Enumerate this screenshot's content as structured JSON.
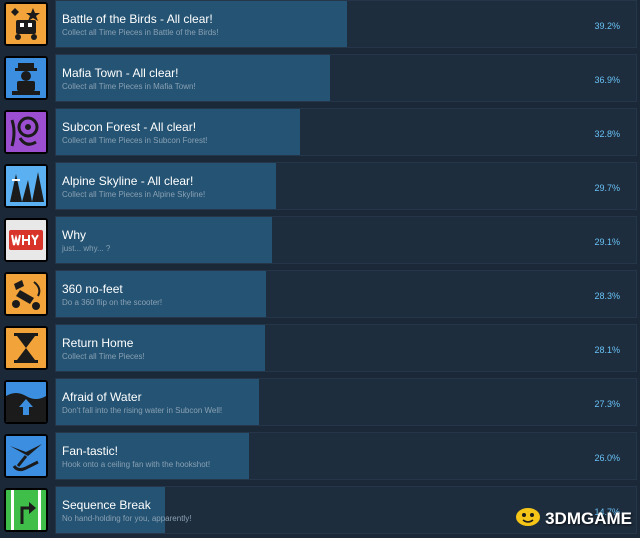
{
  "achievements": [
    {
      "title": "Battle of the Birds - All clear!",
      "description": "Collect all Time Pieces in Battle of the Birds!",
      "percent": "39.2%",
      "progress": 39.2,
      "icon": "birds-stage-icon",
      "icon_bg": "#f2a43a"
    },
    {
      "title": "Mafia Town - All clear!",
      "description": "Collect all Time Pieces in Mafia Town!",
      "percent": "36.9%",
      "progress": 36.9,
      "icon": "mafia-boss-icon",
      "icon_bg": "#3c8fe0"
    },
    {
      "title": "Subcon Forest - All clear!",
      "description": "Collect all Time Pieces in Subcon Forest!",
      "percent": "32.8%",
      "progress": 32.8,
      "icon": "subcon-spirit-icon",
      "icon_bg": "#9b4fd0"
    },
    {
      "title": "Alpine Skyline - All clear!",
      "description": "Collect all Time Pieces in Alpine Skyline!",
      "percent": "29.7%",
      "progress": 29.7,
      "icon": "mountain-peaks-icon",
      "icon_bg": "#5ab0f0"
    },
    {
      "title": "Why",
      "description": "just... why... ?",
      "percent": "29.1%",
      "progress": 29.1,
      "icon": "why-sign-icon",
      "icon_bg": "#e8e8e8"
    },
    {
      "title": "360 no-feet",
      "description": "Do a 360 flip on the scooter!",
      "percent": "28.3%",
      "progress": 28.3,
      "icon": "scooter-icon",
      "icon_bg": "#f2a43a"
    },
    {
      "title": "Return Home",
      "description": "Collect all Time Pieces!",
      "percent": "28.1%",
      "progress": 28.1,
      "icon": "hourglass-icon",
      "icon_bg": "#f2a43a"
    },
    {
      "title": "Afraid of Water",
      "description": "Don't fall into the rising water in Subcon Well!",
      "percent": "27.3%",
      "progress": 27.3,
      "icon": "up-arrow-water-icon",
      "icon_bg": "#3c8fe0"
    },
    {
      "title": "Fan-tastic!",
      "description": "Hook onto a ceiling fan with the hookshot!",
      "percent": "26.0%",
      "progress": 26.0,
      "icon": "ceiling-fan-icon",
      "icon_bg": "#3c8fe0"
    },
    {
      "title": "Sequence Break",
      "description": "No hand-holding for you, apparently!",
      "percent": "14.7%",
      "progress": 14.7,
      "icon": "turn-arrow-icon",
      "icon_bg": "#3fbf4a"
    }
  ],
  "watermark": {
    "text": "3DMGAME",
    "icon": "3dm-logo-icon"
  }
}
